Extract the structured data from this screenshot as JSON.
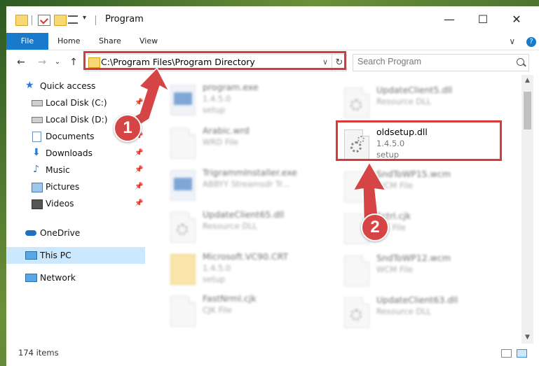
{
  "window": {
    "title": "Program",
    "controls": {
      "minimize": "—",
      "maximize": "☐",
      "close": "✕"
    }
  },
  "ribbon": {
    "tabs": [
      "File",
      "Home",
      "Share",
      "View"
    ],
    "chevron": "∨",
    "help": "?"
  },
  "nav_buttons": {
    "back": "←",
    "forward": "→",
    "recent": "⌄",
    "up": "↑"
  },
  "address": {
    "path": "C:\\Program Files\\Program Directory",
    "dropdown": "∨",
    "refresh": "↻"
  },
  "search": {
    "placeholder": "Search Program"
  },
  "sidebar": {
    "items": [
      {
        "label": "Quick access",
        "icon": "star-icon",
        "pinned": false
      },
      {
        "label": "Local Disk (C:)",
        "icon": "drive-icon",
        "pinned": true
      },
      {
        "label": "Local Disk (D:)",
        "icon": "drive-icon",
        "pinned": true
      },
      {
        "label": "Documents",
        "icon": "documents-icon",
        "pinned": true
      },
      {
        "label": "Downloads",
        "icon": "downloads-icon",
        "pinned": true
      },
      {
        "label": "Music",
        "icon": "music-icon",
        "pinned": true
      },
      {
        "label": "Pictures",
        "icon": "pictures-icon",
        "pinned": true
      },
      {
        "label": "Videos",
        "icon": "videos-icon",
        "pinned": true
      },
      {
        "label": "OneDrive",
        "icon": "cloud-icon",
        "pinned": false
      },
      {
        "label": "This PC",
        "icon": "computer-icon",
        "pinned": false,
        "selected": true
      },
      {
        "label": "Network",
        "icon": "network-icon",
        "pinned": false
      }
    ],
    "pin_glyph": "📌"
  },
  "files": {
    "left_column": [
      {
        "name": "program.exe",
        "line2": "1.4.5.0",
        "line3": "setup",
        "icon": "app-icon"
      },
      {
        "name": "Arabic.wrd",
        "line2": "WRD File",
        "line3": "",
        "icon": "file-icon"
      },
      {
        "name": "TrigrammInstaller.exe",
        "line2": "ABBYY Streamsdr Tr...",
        "line3": "",
        "icon": "exe-icon"
      },
      {
        "name": "UpdateClient65.dll",
        "line2": "Resource DLL",
        "line3": "",
        "icon": "dll-icon"
      },
      {
        "name": "Microsoft.VC90.CRT",
        "line2": "1.4.5.0",
        "line3": "setup",
        "icon": "folder-icon"
      },
      {
        "name": "FastNrml.cjk",
        "line2": "CJK File",
        "line3": "",
        "icon": "file-icon"
      }
    ],
    "right_column": [
      {
        "name": "UpdateClient5.dll",
        "line2": "Resource DLL",
        "line3": "",
        "icon": "dll-icon"
      },
      {
        "name": "oldsetup.dll",
        "line2": "1.4.5.0",
        "line3": "setup",
        "icon": "dll-icon",
        "highlighted": true
      },
      {
        "name": "SndToWP15.wcm",
        "line2": "WCM File",
        "line3": "",
        "icon": "file-icon"
      },
      {
        "name": "Fctrl.cjk",
        "line2": "CJK File",
        "line3": "",
        "icon": "file-icon"
      },
      {
        "name": "SndToWP12.wcm",
        "line2": "WCM File",
        "line3": "",
        "icon": "file-icon"
      },
      {
        "name": "UpdateClient63.dll",
        "line2": "Resource DLL",
        "line3": "",
        "icon": "dll-icon"
      }
    ]
  },
  "status": {
    "item_count": "174 items"
  },
  "annotations": {
    "marker1": "1",
    "marker2": "2",
    "highlight_color": "#d63a3a"
  },
  "colors": {
    "accent": "#1979ca",
    "selection": "#cce8ff"
  }
}
